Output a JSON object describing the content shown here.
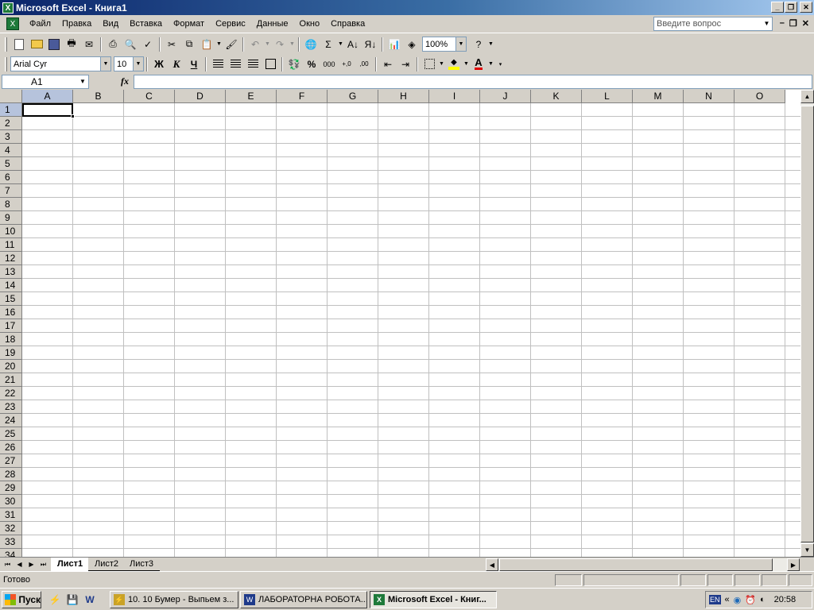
{
  "window": {
    "title": "Microsoft Excel - Книга1",
    "icon": "excel-icon"
  },
  "menu": {
    "items": [
      "Файл",
      "Правка",
      "Вид",
      "Вставка",
      "Формат",
      "Сервис",
      "Данные",
      "Окно",
      "Справка"
    ],
    "question_placeholder": "Введите вопрос"
  },
  "toolbar": {
    "zoom": "100%",
    "font_name": "Arial Cyr",
    "font_size": "10",
    "bold": "Ж",
    "italic": "К",
    "underline": "Ч",
    "percent": "%",
    "thousands": "000",
    "inc_decimal": "+,0",
    "dec_decimal": ",00",
    "sum": "Σ",
    "chart_icon": "chart-icon"
  },
  "formula_bar": {
    "name_box": "A1",
    "fx": "fx",
    "value": ""
  },
  "grid": {
    "columns": [
      "A",
      "B",
      "C",
      "D",
      "E",
      "F",
      "G",
      "H",
      "I",
      "J",
      "K",
      "L",
      "M",
      "N",
      "O"
    ],
    "rows": [
      "1",
      "2",
      "3",
      "4",
      "5",
      "6",
      "7",
      "8",
      "9",
      "10",
      "11",
      "12",
      "13",
      "14",
      "15",
      "16",
      "17",
      "18",
      "19",
      "20",
      "21",
      "22",
      "23",
      "24",
      "25",
      "26",
      "27",
      "28",
      "29",
      "30",
      "31",
      "32",
      "33",
      "34"
    ],
    "active_cell": "A1"
  },
  "sheets": {
    "tabs": [
      "Лист1",
      "Лист2",
      "Лист3"
    ],
    "active": "Лист1"
  },
  "status": {
    "text": "Готово"
  },
  "taskbar": {
    "start": "Пуск",
    "tasks": [
      {
        "label": "10. 10 Бумер - Выпьем з...",
        "icon": "winamp-icon",
        "active": false
      },
      {
        "label": "ЛАБОРАТОРНА РОБОТА...",
        "icon": "word-icon",
        "active": false
      },
      {
        "label": "Microsoft Excel - Книг...",
        "icon": "excel-icon",
        "active": true
      }
    ],
    "tray": {
      "lang": "EN",
      "chevron": "«",
      "time": "20:58"
    }
  }
}
